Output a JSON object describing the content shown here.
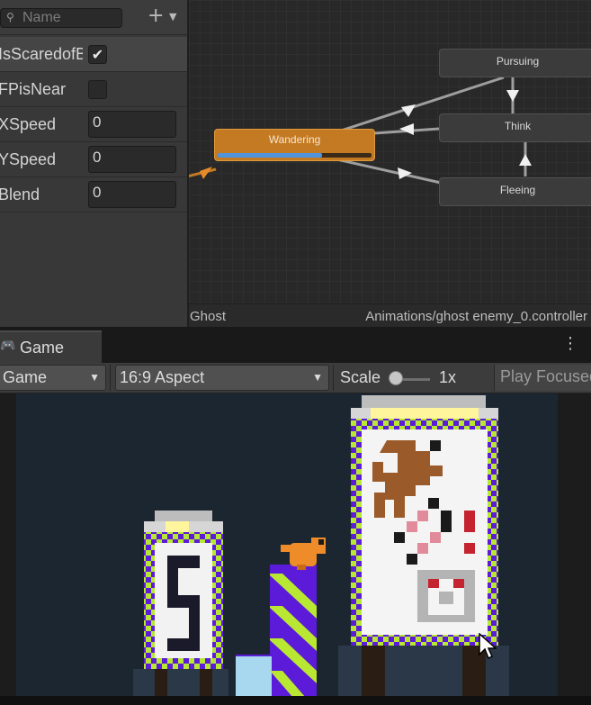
{
  "parameters": {
    "search": {
      "placeholder": "Name",
      "value": ""
    },
    "add_label": "+",
    "rows": [
      {
        "label": "IsScaredofB",
        "type": "bool",
        "checked": true
      },
      {
        "label": "FPisNear",
        "type": "bool",
        "checked": false
      },
      {
        "label": "XSpeed",
        "type": "float",
        "value": "0"
      },
      {
        "label": "YSpeed",
        "type": "float",
        "value": "0"
      },
      {
        "label": "Blend",
        "type": "float",
        "value": "0"
      }
    ]
  },
  "animator": {
    "states": {
      "wandering": "Wandering",
      "pursuing": "Pursuing",
      "think": "Think",
      "fleeing": "Fleeing"
    },
    "wandering_progress": 0.68,
    "footer_left": "Ghost",
    "footer_right": "Animations/ghost enemy_0.controller"
  },
  "game": {
    "tab_label": "Game",
    "display_dropdown": "Game",
    "aspect_dropdown": "16:9 Aspect",
    "scale_label": "Scale",
    "scale_value": "1x",
    "play_focused": "Play Focused"
  },
  "colors": {
    "state_active": "#c47a22",
    "progress": "#4f94dc",
    "game_bg": "#1c2630",
    "border_purple": "#5b1bd9",
    "border_lime": "#b9e833",
    "character": "#ef8c2a",
    "card_red": "#c4232f",
    "card_pink": "#e08a9a",
    "card_brown": "#9a5a2a"
  },
  "icons": {
    "search": "magnifier-icon",
    "add": "plus-icon",
    "check": "checkmark-icon",
    "game_tab": "gamepad-icon",
    "more": "kebab-menu-icon",
    "cursor": "mouse-pointer-icon"
  }
}
